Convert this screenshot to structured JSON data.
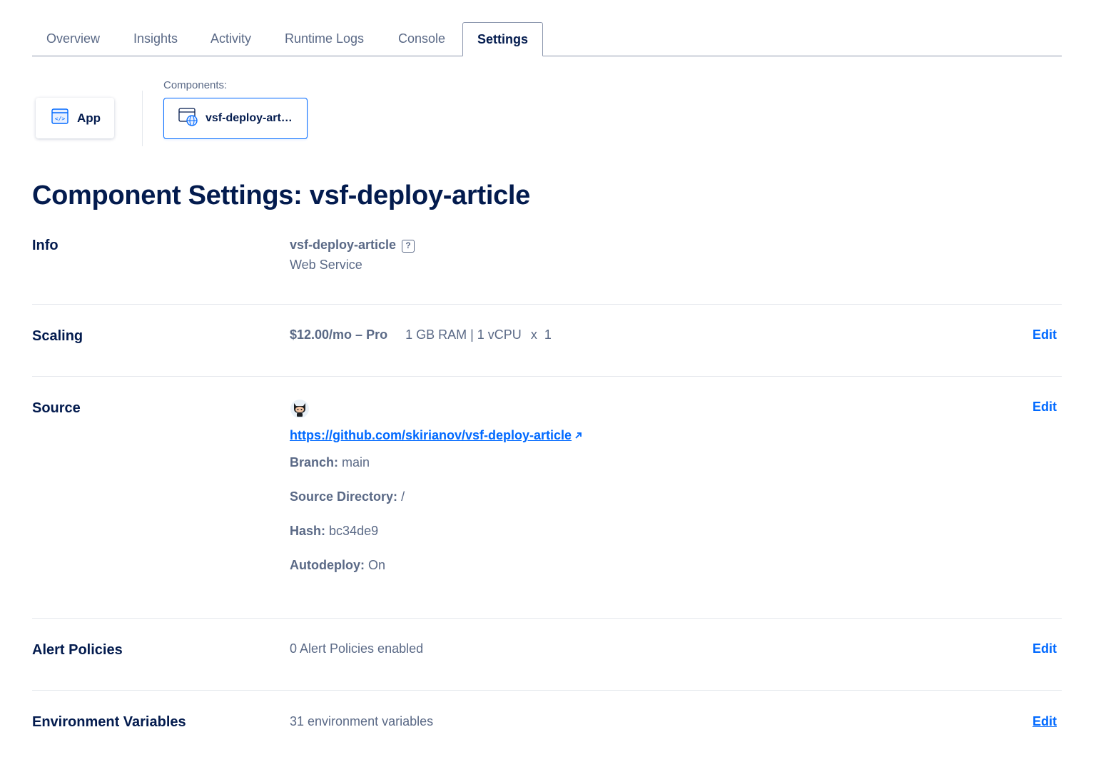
{
  "tabs": [
    {
      "label": "Overview"
    },
    {
      "label": "Insights"
    },
    {
      "label": "Activity"
    },
    {
      "label": "Runtime Logs"
    },
    {
      "label": "Console"
    },
    {
      "label": "Settings",
      "active": true
    }
  ],
  "components": {
    "caption": "Components:",
    "app_label": "App",
    "service_label": "vsf-deploy-article"
  },
  "page_title": "Component Settings: vsf-deploy-article",
  "info": {
    "label": "Info",
    "name": "vsf-deploy-article",
    "help_glyph": "?",
    "type": "Web Service"
  },
  "scaling": {
    "label": "Scaling",
    "price": "$12.00/mo – Pro",
    "spec": "1 GB RAM | 1 vCPU",
    "count": "x  1",
    "edit_label": "Edit"
  },
  "source": {
    "label": "Source",
    "repo_url": "https://github.com/skirianov/vsf-deploy-article",
    "branch_key": "Branch:",
    "branch_value": "main",
    "dir_key": "Source Directory:",
    "dir_value": "/",
    "hash_key": "Hash:",
    "hash_value": "bc34de9",
    "autodeploy_key": "Autodeploy:",
    "autodeploy_value": "On",
    "edit_label": "Edit"
  },
  "alerts": {
    "label": "Alert Policies",
    "value": "0 Alert Policies enabled",
    "edit_label": "Edit"
  },
  "env": {
    "label": "Environment Variables",
    "value": "31 environment variables",
    "edit_label": "Edit"
  },
  "colors": {
    "accent": "#0069ff",
    "heading": "#031b4e",
    "muted": "#5a6986"
  }
}
